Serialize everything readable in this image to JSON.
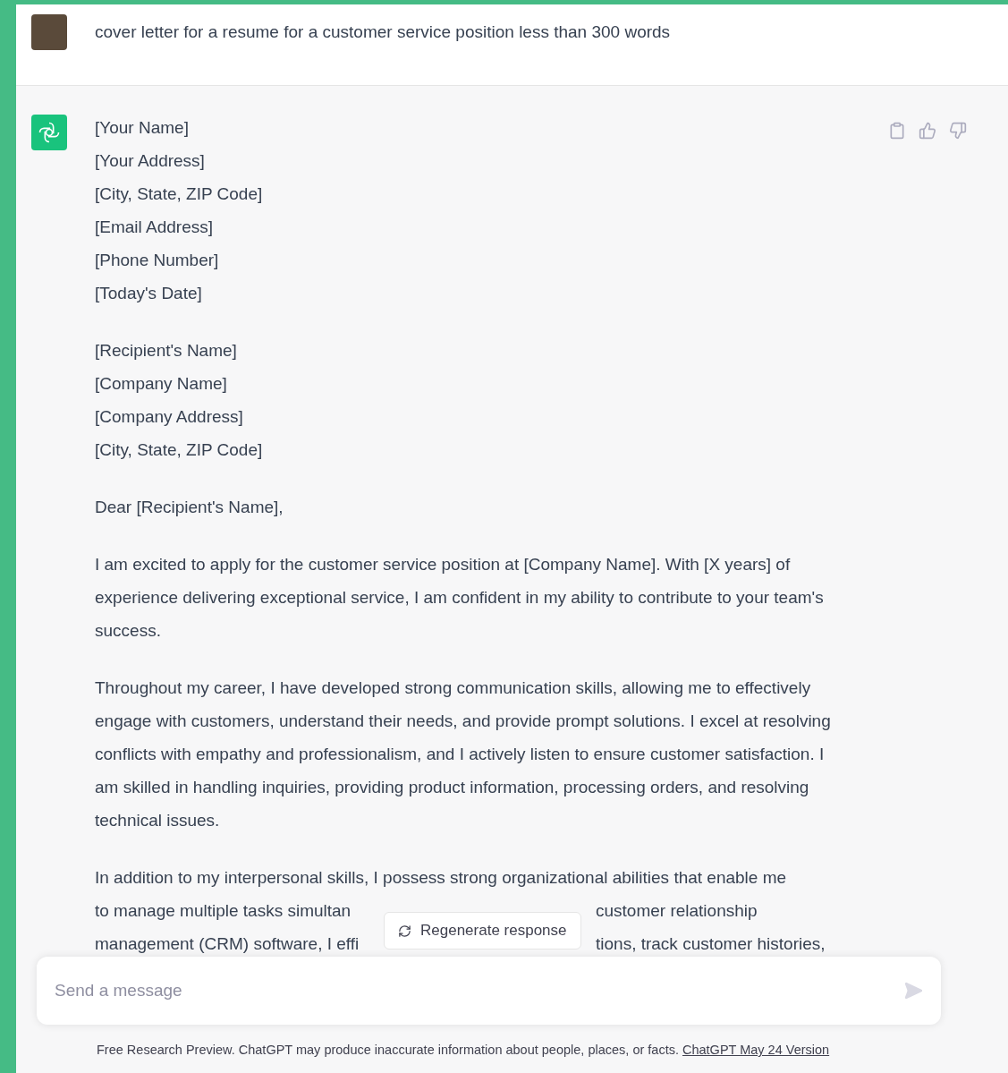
{
  "prompt": {
    "text": "cover letter for a resume for a customer service position less than 300 words"
  },
  "response": {
    "address_lines": [
      "[Your Name]",
      "[Your Address]",
      "[City, State, ZIP Code]",
      "[Email Address]",
      "[Phone Number]",
      "[Today's Date]"
    ],
    "recipient_lines": [
      "[Recipient's Name]",
      "[Company Name]",
      "[Company Address]",
      "[City, State, ZIP Code]"
    ],
    "salutation": "Dear [Recipient's Name],",
    "paragraphs": [
      "I am excited to apply for the customer service position at [Company Name]. With [X years] of experience delivering exceptional service, I am confident in my ability to contribute to your team's success.",
      "Throughout my career, I have developed strong communication skills, allowing me to effectively engage with customers, understand their needs, and provide prompt solutions. I excel at resolving conflicts with empathy and professionalism, and I actively listen to ensure customer satisfaction. I am skilled in handling inquiries, providing product information, processing orders, and resolving technical issues."
    ],
    "last_paragraph": {
      "first_line": "In addition to my interpersonal skills, I possess strong organizational abilities that enable me",
      "covered_lines": [
        {
          "left": "to manage multiple tasks simultan",
          "right": "customer relationship"
        },
        {
          "left": "management (CRM) software, I effi",
          "right": "tions, track customer histories,"
        }
      ]
    }
  },
  "regenerate_button": {
    "label": "Regenerate response"
  },
  "composer": {
    "placeholder": "Send a message"
  },
  "footer": {
    "text": "Free Research Preview. ChatGPT may produce inaccurate information about people, places, or facts.",
    "link": "ChatGPT May 24 Version"
  }
}
